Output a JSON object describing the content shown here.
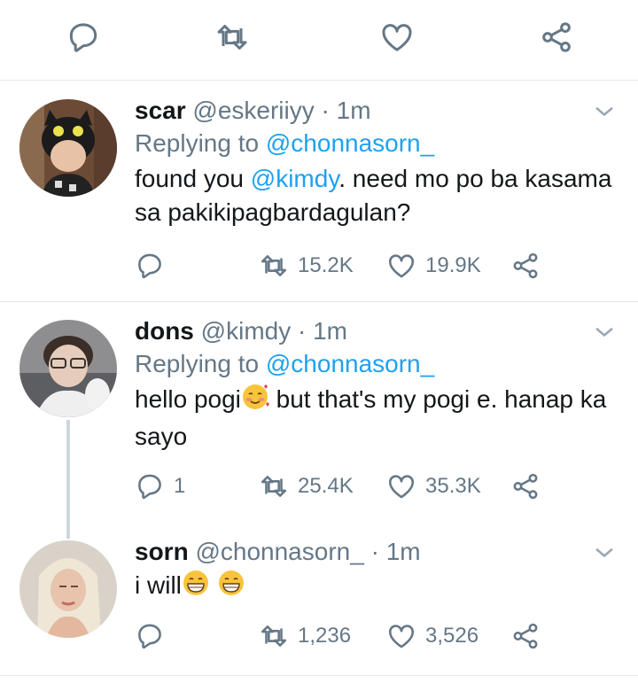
{
  "colors": {
    "link": "#1da1f2",
    "muted": "#657786",
    "text": "#14171a",
    "divider": "#e1e8ed",
    "thread": "#ccd6dd"
  },
  "top_actions": [
    {
      "icon": "reply-icon"
    },
    {
      "icon": "retweet-icon"
    },
    {
      "icon": "heart-icon"
    },
    {
      "icon": "share-icon"
    }
  ],
  "tweets": [
    {
      "name": "scar",
      "handle": "@eskeriiyy",
      "dot": "·",
      "time": "1m",
      "replying_prefix": "Replying to ",
      "replying_to": "@chonnasorn_",
      "body_pre": "found you ",
      "mention": "@kimdy",
      "body_post": ". need mo po ba kasama sa pakikipagbardagulan?",
      "replies": "",
      "retweets": "15.2K",
      "likes": "19.9K"
    },
    {
      "name": "dons",
      "handle": "@kimdy",
      "dot": "·",
      "time": "1m",
      "replying_prefix": "Replying to ",
      "replying_to": "@chonnasorn_",
      "body_pre": "hello pogi",
      "emoji": "smiling-face-with-hearts",
      "body_post": " but that's my pogi e. hanap ka sayo",
      "replies": "1",
      "retweets": "25.4K",
      "likes": "35.3K"
    },
    {
      "name": "sorn",
      "handle": "@chonnasorn_",
      "dot": "·",
      "time": "1m",
      "body_pre": "i will",
      "emojis": [
        "grinning-face",
        "grinning-face"
      ],
      "replies": "",
      "retweets": "1,236",
      "likes": "3,526"
    }
  ]
}
